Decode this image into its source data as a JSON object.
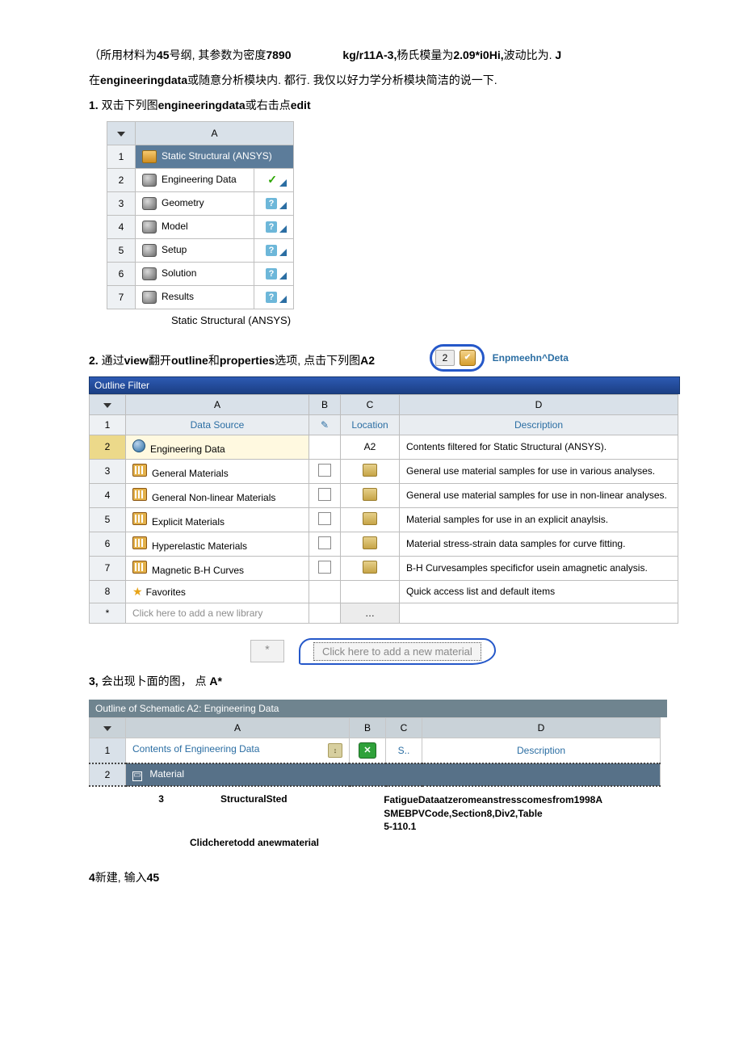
{
  "intro": {
    "line1_a": "（所用材料为",
    "line1_b": "45",
    "line1_c": "号纲, 其参数为密度",
    "line1_d": "7890",
    "line1_e": "kg/r11A-3,",
    "line1_f": "杨氏模量为",
    "line1_g": "2.09*i0Hi,",
    "line1_h": "波动比为.",
    "line1_i": " J",
    "line2_a": "在",
    "line2_b": "engineeringdata",
    "line2_c": "或随意分析模块内. 都行. 我仅以好力学分析模块简洁的说一下."
  },
  "step1": {
    "label": "1.",
    "text1": " 双击下列图",
    "b1": "engineeringdata",
    "text2": "或右击点",
    "b2": "edit"
  },
  "wbtable": {
    "colA": "A",
    "rows": [
      {
        "idx": "1",
        "label": "Static Structural (ANSYS)",
        "title": true
      },
      {
        "idx": "2",
        "label": "Engineering Data",
        "status": "check"
      },
      {
        "idx": "3",
        "label": "Geometry",
        "status": "q"
      },
      {
        "idx": "4",
        "label": "Model",
        "status": "q"
      },
      {
        "idx": "5",
        "label": "Setup",
        "status": "q"
      },
      {
        "idx": "6",
        "label": "Solution",
        "status": "q"
      },
      {
        "idx": "7",
        "label": "Results",
        "status": "q"
      }
    ],
    "caption": "Static Structural (ANSYS)"
  },
  "step2": {
    "label": "2.",
    "t1": " 通过",
    "b1": "view",
    "t2": "翻开",
    "b2": "outline",
    "t3": "和",
    "b3": "properties",
    "t4": "选项, 点击下列图",
    "b4": "A2"
  },
  "bubble": {
    "num": "2",
    "label": "Enpmeehn^Deta"
  },
  "filter": {
    "title": "Outline Filter",
    "cols": {
      "A": "A",
      "B": "B",
      "C": "C",
      "D": "D"
    },
    "sub": {
      "A": "Data Source",
      "C": "Location",
      "D": "Description"
    },
    "rows": [
      {
        "idx": "2",
        "A": "Engineering Data",
        "C": "A2",
        "D": "Contents filtered for Static Structural (ANSYS).",
        "hi": true,
        "ed": true
      },
      {
        "idx": "3",
        "A": "General Materials",
        "chk": true,
        "loc": true,
        "D": "General use material samples for use in various analyses."
      },
      {
        "idx": "4",
        "A": "General Non-linear Materials",
        "chk": true,
        "loc": true,
        "D": "General use material samples for use in non-linear analyses."
      },
      {
        "idx": "5",
        "A": "Explicit Materials",
        "chk": true,
        "loc": true,
        "D": "Material samples for use in an explicit anaylsis."
      },
      {
        "idx": "6",
        "A": "Hyperelastic Materials",
        "chk": true,
        "loc": true,
        "D": "Material stress-strain data samples for curve fitting."
      },
      {
        "idx": "7",
        "A": "Magnetic B-H Curves",
        "chk": true,
        "loc": true,
        "D": "B-H Curvesamples specificfor usein amagnetic analysis."
      },
      {
        "idx": "8",
        "A": "Favorites",
        "fav": true,
        "D": "Quick access list and default items"
      },
      {
        "idx": "*",
        "A": "Click here to add a new library",
        "ghost": true,
        "dots": true
      }
    ]
  },
  "addmat": {
    "star": "*",
    "text": "Click here to add a new material"
  },
  "step3": {
    "label": "3,",
    "t1": " 会出现卜面的图，",
    "t2": "点 ",
    "b": "A*"
  },
  "schema": {
    "title": "Outline of Schematic A2: Engineering Data",
    "cols": {
      "A": "A",
      "B": "B",
      "C": "C",
      "D": "D"
    },
    "sub": {
      "A": "Contents of Engineering Data",
      "C": "S..",
      "D": "Description"
    },
    "row2": {
      "idx": "2",
      "label": "Material"
    },
    "row3": {
      "idx": "3",
      "A": "StructuralSted",
      "D1": "FatigueDataatzeromeanstresscomesfrom1998A",
      "D2": "SMEBPVCode,Section8,Div2,Table",
      "D3": "5-110.1"
    },
    "clid": "Clidcheretodd anewmaterial"
  },
  "step4": {
    "label": "4",
    "t1": "新建, 输入",
    "b": "45"
  }
}
